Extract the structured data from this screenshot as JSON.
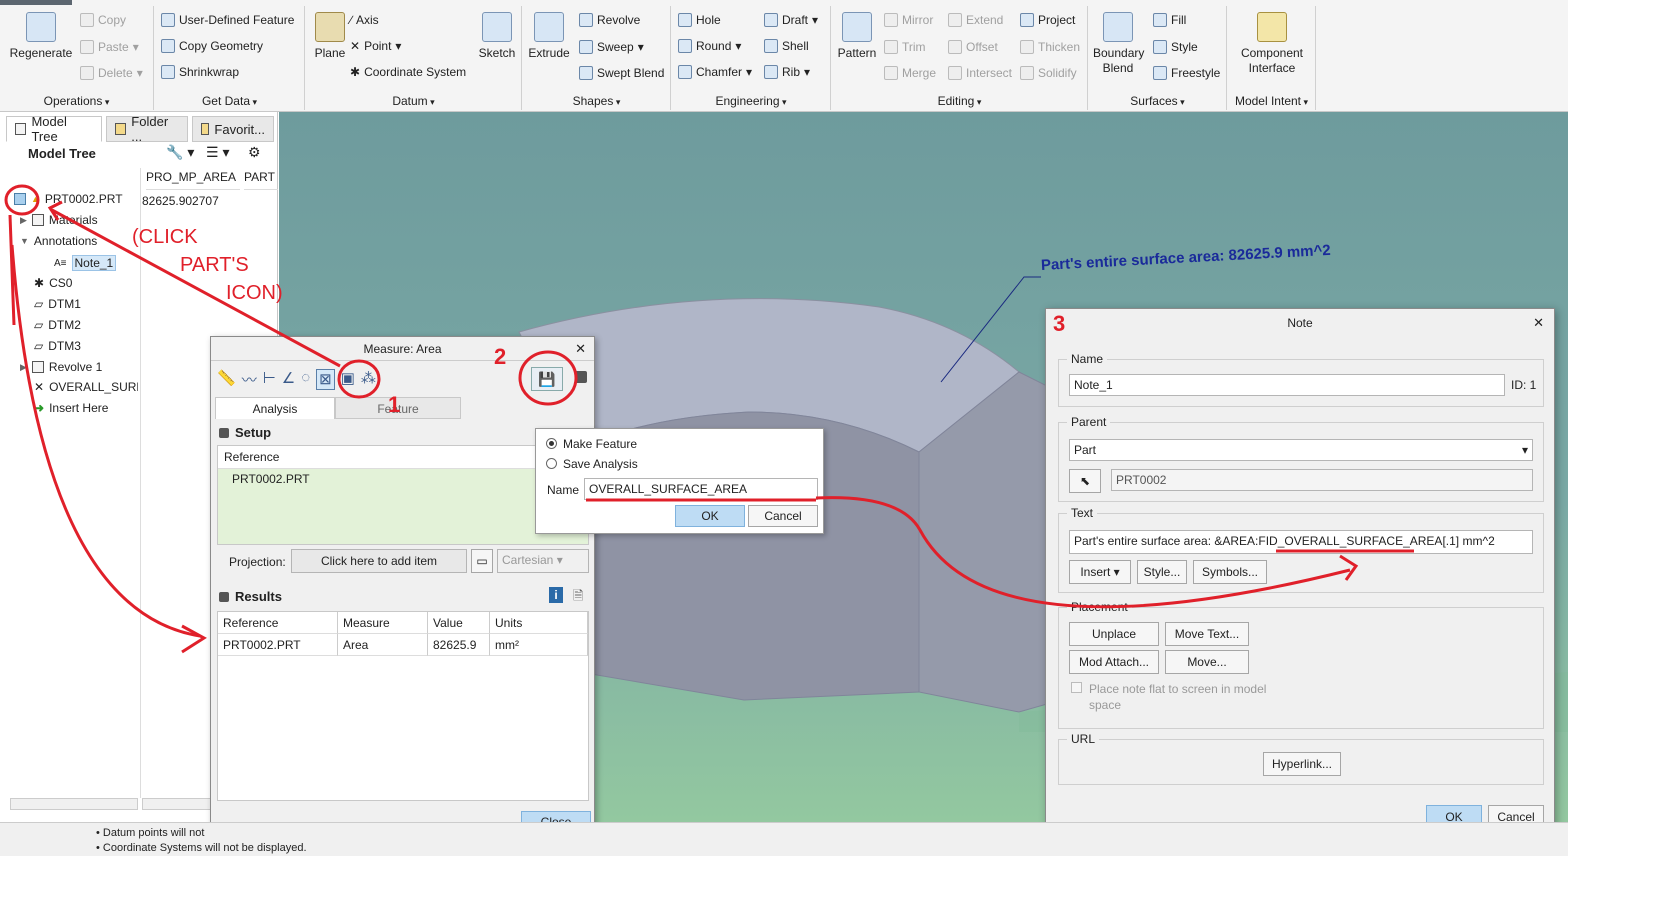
{
  "ribbon": {
    "operations": {
      "regenerate": "Regenerate",
      "copy": "Copy",
      "paste": "Paste",
      "delete": "Delete",
      "label": "Operations"
    },
    "get_data": {
      "udf": "User-Defined Feature",
      "copy_geometry": "Copy Geometry",
      "shrinkwrap": "Shrinkwrap",
      "label": "Get Data"
    },
    "datum": {
      "plane": "Plane",
      "axis": "Axis",
      "point": "Point",
      "csys": "Coordinate System",
      "sketch": "Sketch",
      "label": "Datum"
    },
    "shapes": {
      "extrude": "Extrude",
      "revolve": "Revolve",
      "sweep": "Sweep",
      "swept_blend": "Swept Blend",
      "label": "Shapes"
    },
    "engineering": {
      "hole": "Hole",
      "round": "Round",
      "chamfer": "Chamfer",
      "draft": "Draft",
      "shell": "Shell",
      "rib": "Rib",
      "label": "Engineering"
    },
    "editing": {
      "pattern": "Pattern",
      "mirror": "Mirror",
      "trim": "Trim",
      "merge": "Merge",
      "extend": "Extend",
      "offset": "Offset",
      "intersect": "Intersect",
      "project": "Project",
      "thicken": "Thicken",
      "solidify": "Solidify",
      "label": "Editing"
    },
    "surfaces": {
      "boundary_blend": "Boundary Blend",
      "fill": "Fill",
      "style": "Style",
      "freestyle": "Freestyle",
      "label": "Surfaces"
    },
    "model_intent": {
      "component_interface": "Component Interface",
      "label": "Model Intent"
    }
  },
  "left_panel": {
    "tabs": [
      "Model Tree",
      "Folder ...",
      "Favorit..."
    ],
    "tree_title": "Model Tree",
    "columns": [
      "PRO_MP_AREA",
      "PART"
    ],
    "items": [
      "PRT0002.PRT",
      "Materials",
      "Annotations",
      "Note_1",
      "CS0",
      "DTM1",
      "DTM2",
      "DTM3",
      "Revolve 1",
      "OVERALL_SURFAC",
      "Insert Here"
    ],
    "area_value": "82625.902707"
  },
  "viewport": {
    "note_text": "Part's entire surface area: 82625.9 mm^2"
  },
  "measure_dialog": {
    "title": "Measure: Area",
    "tabs": [
      "Analysis",
      "Feature"
    ],
    "setup": "Setup",
    "reference_header": "Reference",
    "reference_value": "PRT0002.PRT",
    "projection_label": "Projection:",
    "projection_placeholder": "Click here to add item",
    "cartesian": "Cartesian",
    "results": "Results",
    "result_columns": [
      "Reference",
      "Measure",
      "Value",
      "Units"
    ],
    "result_row": [
      "PRT0002.PRT",
      "Area",
      "82625.9",
      "mm²"
    ],
    "close": "Close"
  },
  "save_popup": {
    "make_feature": "Make Feature",
    "save_analysis": "Save Analysis",
    "name_label": "Name",
    "name_value": "OVERALL_SURFACE_AREA",
    "ok": "OK",
    "cancel": "Cancel"
  },
  "note_dialog": {
    "title": "Note",
    "name_label": "Name",
    "name_value": "Note_1",
    "id": "ID: 1",
    "parent_label": "Parent",
    "parent_value": "Part",
    "parent_ref": "PRT0002",
    "text_label": "Text",
    "text_value": "Part's entire surface area: &AREA:FID_OVERALL_SURFACE_AREA[.1] mm^2",
    "insert": "Insert",
    "style": "Style...",
    "symbols": "Symbols...",
    "placement_label": "Placement",
    "unplace": "Unplace",
    "move_text": "Move Text...",
    "mod_attach": "Mod Attach...",
    "move": "Move...",
    "flat_checkbox": "Place note flat to screen in model space",
    "url_label": "URL",
    "hyperlink": "Hyperlink...",
    "ok": "OK",
    "cancel": "Cancel"
  },
  "annotations": {
    "click_line1": "(CLICK",
    "click_line2": "PART'S",
    "click_line3": "ICON)",
    "step1": "1",
    "step2": "2",
    "step3": "3"
  },
  "status": {
    "line1": "• Datum points will not",
    "line2": "• Coordinate Systems will not be displayed."
  }
}
